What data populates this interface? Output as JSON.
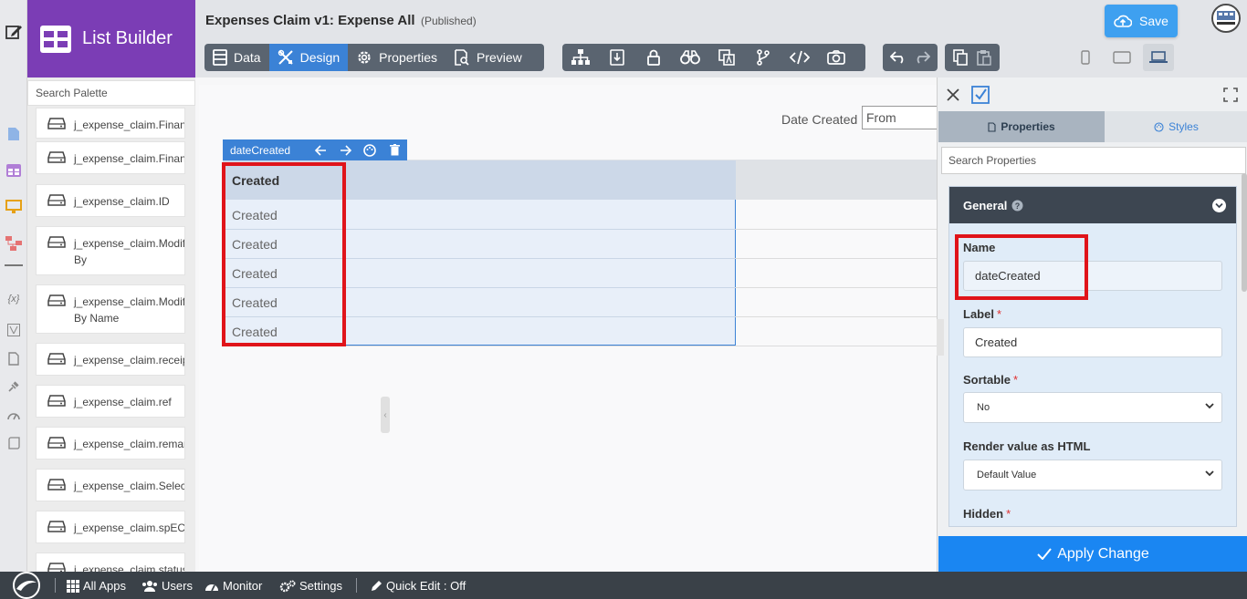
{
  "brand": {
    "title": "List Builder"
  },
  "header": {
    "app_title": "Expenses Claim v1: Expense All",
    "app_status": "(Published)",
    "tabs": [
      {
        "label": "Data",
        "icon": "table-icon",
        "active": false
      },
      {
        "label": "Design",
        "icon": "design-tools-icon",
        "active": true
      },
      {
        "label": "Properties",
        "icon": "gear-icon",
        "active": false
      },
      {
        "label": "Preview",
        "icon": "preview-icon",
        "active": false
      }
    ],
    "tool_icons": [
      "sitemap-icon",
      "import-icon",
      "lock-icon",
      "binoculars-icon",
      "i18n-icon",
      "branch-icon",
      "code-icon",
      "camera-icon"
    ],
    "save_label": "Save",
    "device_icons": [
      "mobile-icon",
      "tablet-icon",
      "laptop-icon"
    ]
  },
  "palette": {
    "search_placeholder": "Search Palette",
    "items": [
      "j_expense_claim.FinanceApprover",
      "j_expense_claim.FinanceApprovedDate",
      "j_expense_claim.ID",
      "j_expense_claim.Modified By",
      "j_expense_claim.Modified By Name",
      "j_expense_claim.receipt",
      "j_expense_claim.ref",
      "j_expense_claim.remark",
      "j_expense_claim.SelectApprover",
      "j_expense_claim.spECD",
      "j_expense_claim.status"
    ]
  },
  "canvas": {
    "filter_label": "Date Created",
    "filter_from_placeholder": "From",
    "column_toolbar_name": "dateCreated",
    "column_header": "Created",
    "cells": [
      "Created",
      "Created",
      "Created",
      "Created",
      "Created"
    ]
  },
  "props": {
    "tab_properties": "Properties",
    "tab_styles": "Styles",
    "search_placeholder": "Search Properties",
    "section_title": "General",
    "fields": {
      "name_label": "Name",
      "name_value": "dateCreated",
      "label_label": "Label",
      "label_value": "Created",
      "sortable_label": "Sortable",
      "sortable_value": "No",
      "render_html_label": "Render value as HTML",
      "render_html_value": "Default Value",
      "hidden_label": "Hidden"
    },
    "apply_label": "Apply Change"
  },
  "footer": {
    "items": [
      "All Apps",
      "Users",
      "Monitor",
      "Settings",
      "Quick Edit : Off"
    ]
  },
  "colors": {
    "brand_purple": "#7b3db5",
    "accent_blue": "#3b82d6",
    "apply_blue": "#1a86f2",
    "highlight_red": "#e0141a",
    "toolbar_gray": "#5a6470",
    "footer_dark": "#3a4148"
  }
}
